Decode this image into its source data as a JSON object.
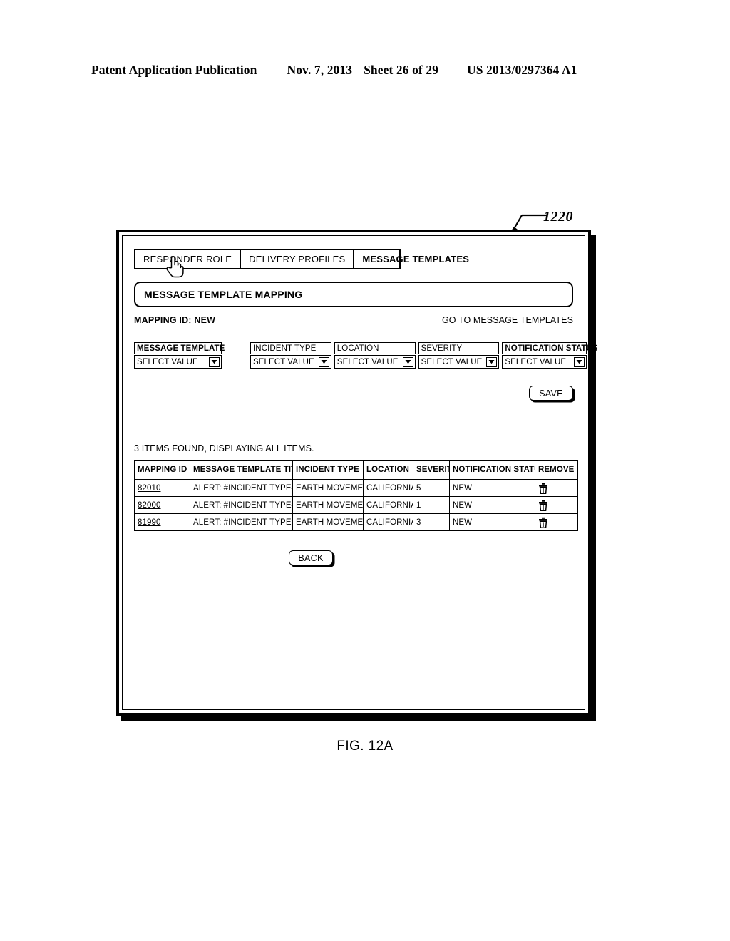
{
  "patent_header": {
    "publication": "Patent Application Publication",
    "date": "Nov. 7, 2013",
    "sheet": "Sheet 26 of 29",
    "number": "US 2013/0297364 A1"
  },
  "callout": {
    "ref": "1220"
  },
  "figure": {
    "caption": "FIG. 12A"
  },
  "screen": {
    "tabs": [
      {
        "label": "RESPONDER ROLE",
        "active": false
      },
      {
        "label": "DELIVERY PROFILES",
        "active": false
      },
      {
        "label": "MESSAGE TEMPLATES",
        "active": true
      }
    ],
    "title": "MESSAGE TEMPLATE MAPPING",
    "mapping_id_label": "MAPPING ID: NEW",
    "go_to_link": "GO TO MESSAGE TEMPLATES",
    "filters": [
      {
        "label": "MESSAGE TEMPLATE",
        "value": "SELECT VALUE",
        "bold": true
      },
      {
        "label": "INCIDENT TYPE",
        "value": "SELECT VALUE",
        "bold": false
      },
      {
        "label": "LOCATION",
        "value": "SELECT VALUE",
        "bold": false
      },
      {
        "label": "SEVERITY",
        "value": "SELECT VALUE",
        "bold": false
      },
      {
        "label": "NOTIFICATION STATUS",
        "value": "SELECT VALUE",
        "bold": true
      }
    ],
    "save_label": "SAVE",
    "results_text": "3 ITEMS FOUND, DISPLAYING ALL ITEMS.",
    "table": {
      "columns": [
        "MAPPING ID",
        "MESSAGE TEMPLATE TITLE",
        "INCIDENT TYPE",
        "LOCATION",
        "SEVERITY",
        "NOTIFICATION STATUS",
        "REMOVE"
      ],
      "rows": [
        {
          "mapping_id": "82010",
          "template_title": "ALERT: #INCIDENT TYPE#",
          "incident_type": "EARTH MOVEMENT",
          "location": "CALIFORNIA",
          "severity": "5",
          "notification_status": "NEW",
          "remove_icon": "trash-icon"
        },
        {
          "mapping_id": "82000",
          "template_title": "ALERT: #INCIDENT TYPE#",
          "incident_type": "EARTH MOVEMENT",
          "location": "CALIFORNIA",
          "severity": "1",
          "notification_status": "NEW",
          "remove_icon": "trash-icon"
        },
        {
          "mapping_id": "81990",
          "template_title": "ALERT: #INCIDENT TYPE#",
          "incident_type": "EARTH MOVEMENT",
          "location": "CALIFORNIA",
          "severity": "3",
          "notification_status": "NEW",
          "remove_icon": "trash-icon"
        }
      ]
    },
    "back_label": "BACK",
    "cursor_icon": "hand-pointer-cursor",
    "dropdown_icon": "chevron-down-icon"
  }
}
